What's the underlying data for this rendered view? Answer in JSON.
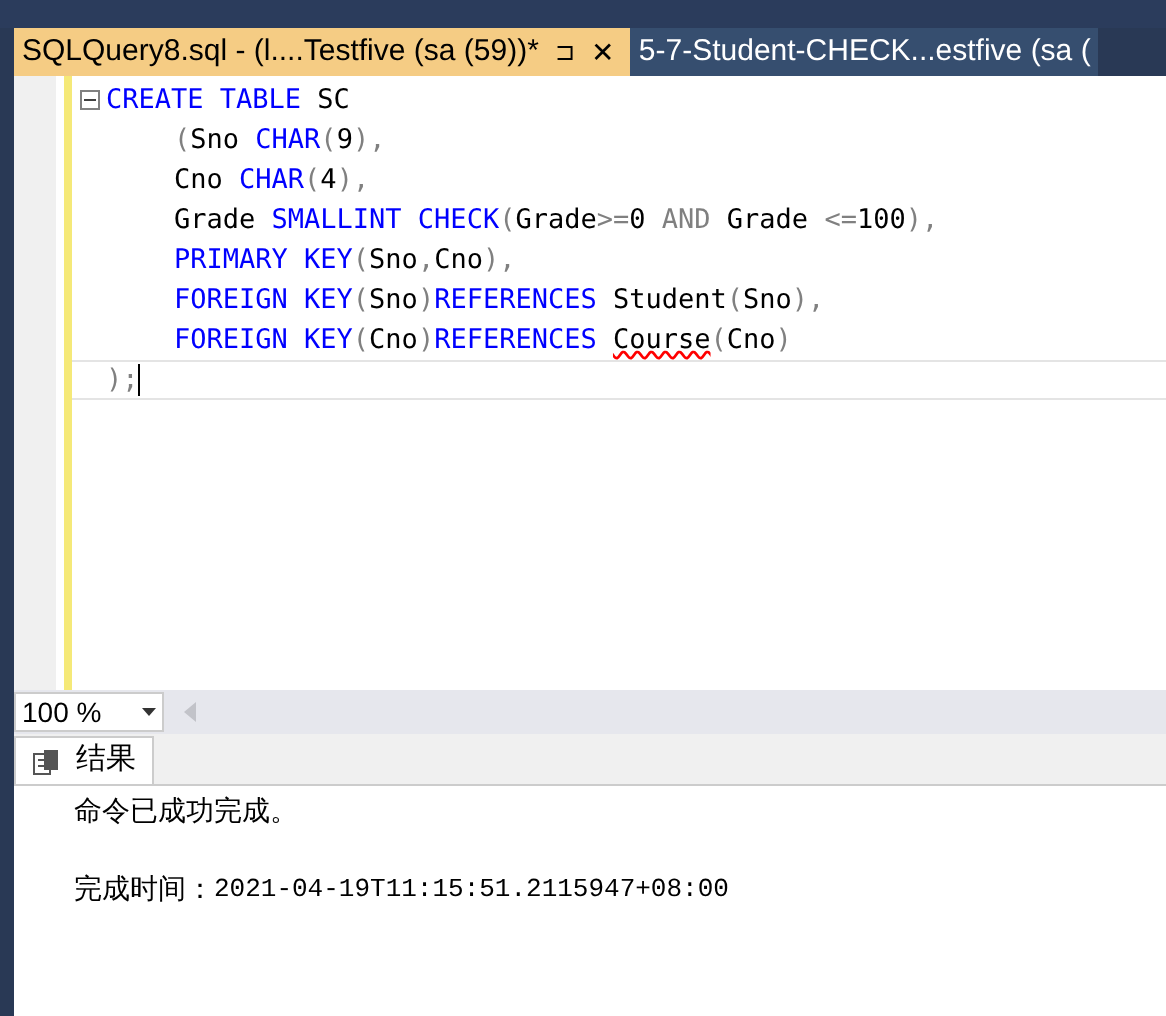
{
  "tabs": [
    {
      "label": "SQLQuery8.sql - (l....Testfive (sa (59))*",
      "selected": true,
      "pin": "⊐",
      "close": "✕"
    },
    {
      "label": "5-7-Student-CHECK...estfive (sa (",
      "selected": false
    }
  ],
  "editor": {
    "lines": [
      {
        "fold": true,
        "indented": false,
        "tokens": [
          {
            "kind": "kw",
            "text": "CREATE TABLE"
          },
          {
            "kind": "id",
            "text": " SC"
          }
        ]
      },
      {
        "fold": false,
        "indented": true,
        "tokens": [
          {
            "kind": "op",
            "text": "("
          },
          {
            "kind": "id",
            "text": "Sno "
          },
          {
            "kind": "kw",
            "text": "CHAR"
          },
          {
            "kind": "op",
            "text": "("
          },
          {
            "kind": "id",
            "text": "9"
          },
          {
            "kind": "op",
            "text": "),"
          }
        ]
      },
      {
        "fold": false,
        "indented": true,
        "tokens": [
          {
            "kind": "id",
            "text": "Cno "
          },
          {
            "kind": "kw",
            "text": "CHAR"
          },
          {
            "kind": "op",
            "text": "("
          },
          {
            "kind": "id",
            "text": "4"
          },
          {
            "kind": "op",
            "text": "),"
          }
        ]
      },
      {
        "fold": false,
        "indented": true,
        "tokens": [
          {
            "kind": "id",
            "text": "Grade "
          },
          {
            "kind": "kw",
            "text": "SMALLINT CHECK"
          },
          {
            "kind": "op",
            "text": "("
          },
          {
            "kind": "id",
            "text": "Grade"
          },
          {
            "kind": "op",
            "text": ">="
          },
          {
            "kind": "id",
            "text": "0 "
          },
          {
            "kind": "op",
            "text": "AND"
          },
          {
            "kind": "id",
            "text": " Grade "
          },
          {
            "kind": "op",
            "text": "<="
          },
          {
            "kind": "id",
            "text": "100"
          },
          {
            "kind": "op",
            "text": "),"
          }
        ]
      },
      {
        "fold": false,
        "indented": true,
        "tokens": [
          {
            "kind": "kw",
            "text": "PRIMARY KEY"
          },
          {
            "kind": "op",
            "text": "("
          },
          {
            "kind": "id",
            "text": "Sno"
          },
          {
            "kind": "op",
            "text": ","
          },
          {
            "kind": "id",
            "text": "Cno"
          },
          {
            "kind": "op",
            "text": "),"
          }
        ]
      },
      {
        "fold": false,
        "indented": true,
        "tokens": [
          {
            "kind": "kw",
            "text": "FOREIGN KEY"
          },
          {
            "kind": "op",
            "text": "("
          },
          {
            "kind": "id",
            "text": "Sno"
          },
          {
            "kind": "op",
            "text": ")"
          },
          {
            "kind": "kw",
            "text": "REFERENCES"
          },
          {
            "kind": "id",
            "text": " Student"
          },
          {
            "kind": "op",
            "text": "("
          },
          {
            "kind": "id",
            "text": "Sno"
          },
          {
            "kind": "op",
            "text": "),"
          }
        ]
      },
      {
        "fold": false,
        "indented": true,
        "tokens": [
          {
            "kind": "kw",
            "text": "FOREIGN KEY"
          },
          {
            "kind": "op",
            "text": "("
          },
          {
            "kind": "id",
            "text": "Cno"
          },
          {
            "kind": "op",
            "text": ")"
          },
          {
            "kind": "kw",
            "text": "REFERENCES "
          },
          {
            "kind": "err",
            "text": "Course"
          },
          {
            "kind": "op",
            "text": "("
          },
          {
            "kind": "id",
            "text": "Cno"
          },
          {
            "kind": "op",
            "text": ")"
          }
        ]
      },
      {
        "fold": false,
        "indented": false,
        "current": true,
        "tokens": [
          {
            "kind": "op",
            "text": ");"
          }
        ]
      }
    ]
  },
  "zoom": {
    "value": "100 %"
  },
  "results": {
    "tab": "结果",
    "message": "命令已成功完成。",
    "completion_label": "完成时间：",
    "completion_time": "2021-04-19T11:15:51.2115947+08:00"
  }
}
